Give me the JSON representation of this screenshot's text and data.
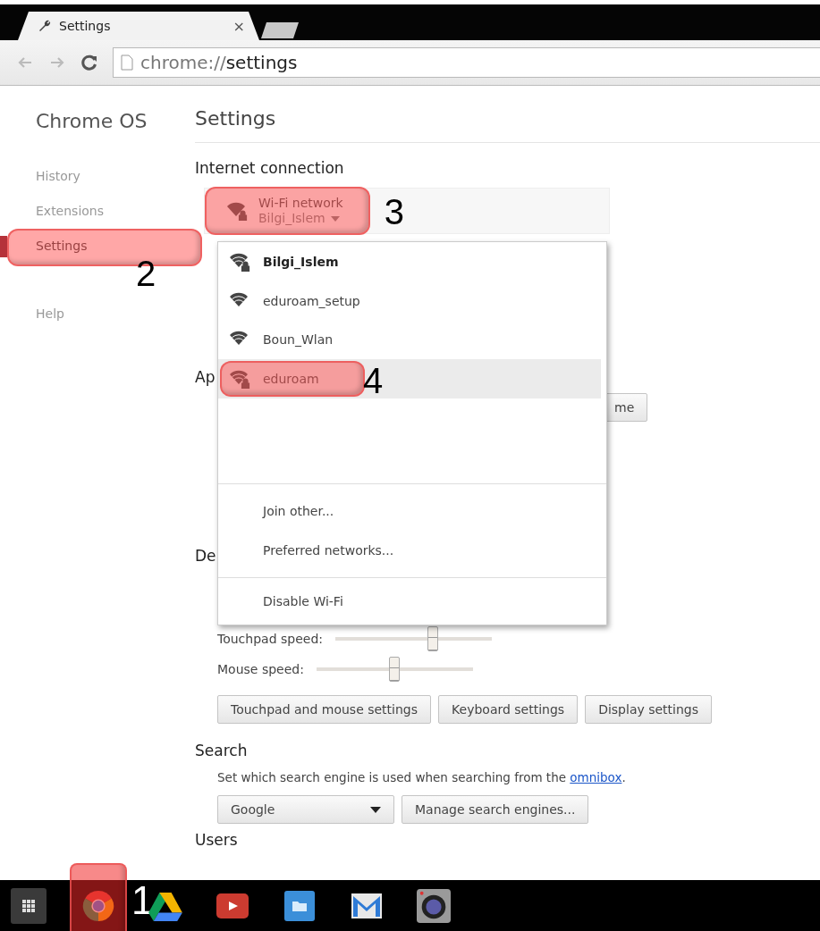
{
  "browser": {
    "tab": {
      "title": "Settings",
      "close": "×"
    },
    "address": {
      "scheme": "chrome://",
      "path": "settings"
    }
  },
  "sidebar": {
    "title": "Chrome OS",
    "groups": [
      [
        {
          "label": "History",
          "selected": false
        },
        {
          "label": "Extensions",
          "selected": false
        },
        {
          "label": "Settings",
          "selected": true,
          "callout": "2"
        }
      ],
      [
        {
          "label": "Help",
          "selected": false
        }
      ]
    ]
  },
  "page_title": "Settings",
  "internet": {
    "heading": "Internet connection",
    "network_button": {
      "label": "Wi-Fi network",
      "value": "Bilgi_Islem",
      "secured": true,
      "callout": "3"
    },
    "menu": {
      "networks": [
        {
          "name": "Bilgi_Islem",
          "connected": true,
          "secured": true,
          "selected": false
        },
        {
          "name": "eduroam_setup",
          "connected": false,
          "secured": false,
          "selected": false
        },
        {
          "name": "Boun_Wlan",
          "connected": false,
          "secured": false,
          "selected": false
        },
        {
          "name": "eduroam",
          "connected": false,
          "secured": true,
          "selected": true,
          "callout": "4"
        }
      ],
      "action_groups": [
        [
          "Join other...",
          "Preferred networks..."
        ],
        [
          "Disable Wi-Fi"
        ]
      ]
    }
  },
  "appearance": {
    "heading": "Ap",
    "button": "me"
  },
  "device": {
    "heading": "De",
    "sliders": [
      {
        "label": "Touchpad speed:",
        "level": 0.62
      },
      {
        "label": "Mouse speed:",
        "level": 0.5
      }
    ],
    "buttons": [
      "Touchpad and mouse settings",
      "Keyboard settings",
      "Display settings"
    ]
  },
  "search": {
    "heading": "Search",
    "text": "Set which search engine is used when searching from the ",
    "link": "omnibox",
    "text_after": ".",
    "engine": "Google",
    "manage_button": "Manage search engines..."
  },
  "users": {
    "heading": "Users"
  },
  "shelf": {
    "apps": [
      {
        "kind": "launcher"
      },
      {
        "kind": "chrome",
        "callout": "1"
      },
      {
        "kind": "drive"
      },
      {
        "kind": "video"
      },
      {
        "kind": "files"
      },
      {
        "kind": "mail"
      },
      {
        "kind": "camera"
      }
    ]
  }
}
